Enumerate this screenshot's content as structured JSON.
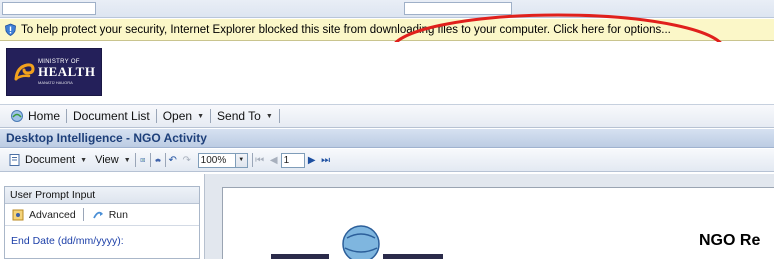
{
  "infobar": {
    "message": "To help protect your security, Internet Explorer blocked this site from downloading files to your computer. Click here for options..."
  },
  "logo": {
    "line1": "MINISTRY OF",
    "line2": "HEALTH",
    "line3": "MANATŪ HAUORA"
  },
  "nav": {
    "items": [
      {
        "label": "Home",
        "icon": "home-icon"
      },
      {
        "label": "Document List"
      },
      {
        "label": "Open",
        "dropdown": true
      },
      {
        "label": "Send To",
        "dropdown": true
      }
    ]
  },
  "document": {
    "title": "Desktop Intelligence - NGO Activity"
  },
  "report_toolbar": {
    "document_label": "Document",
    "view_label": "View",
    "zoom": "100%",
    "page": "1"
  },
  "left_panel": {
    "header": "User Prompt Input",
    "advanced_label": "Advanced",
    "run_label": "Run",
    "field_label": "End Date (dd/mm/yyyy):"
  },
  "report": {
    "title_fragment": "NGO Re"
  },
  "colors": {
    "infobar_bg": "#fbf7c8",
    "annotation": "#e0201c",
    "title_text": "#1d3f7a",
    "logo_bg": "#24205a"
  }
}
